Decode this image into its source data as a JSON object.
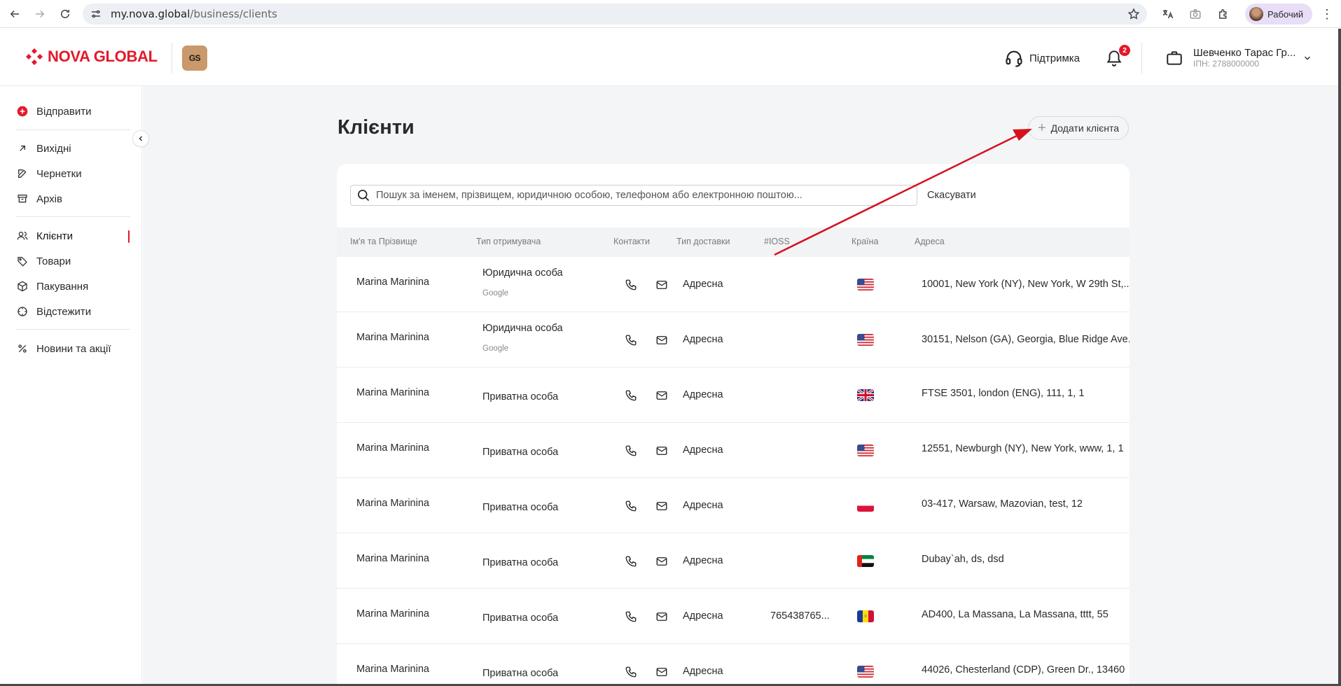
{
  "browser": {
    "url_host": "my.nova.global",
    "url_path": "/business/clients",
    "profile_label": "Рабочий"
  },
  "header": {
    "logo_text": "NOVA GLOBAL",
    "company_badge": "GS",
    "support_label": "Підтримка",
    "notifications_count": "2",
    "account_name": "Шевченко Тарас Гр...",
    "account_inn": "ІПН: 2788000000"
  },
  "sidebar": {
    "send": "Відправити",
    "items_group1": [
      "Вихідні",
      "Чернетки",
      "Архів"
    ],
    "items_group2": [
      "Клієнти",
      "Товари",
      "Пакування",
      "Відстежити"
    ],
    "news": "Новини та акції",
    "active": "Клієнти"
  },
  "page": {
    "title": "Клієнти",
    "add_button": "Додати клієнта",
    "search_placeholder": "Пошук за іменем, прізвищем, юридичною особою, телефоном або електронною поштою...",
    "cancel": "Скасувати"
  },
  "table": {
    "headers": [
      "Ім'я та Прізвище",
      "Тип отримувача",
      "Контакти",
      "Тип доставки",
      "#IOSS",
      "Країна",
      "Адреса"
    ],
    "rows": [
      {
        "name": "Marina Marinina",
        "type": "Юридична особа",
        "subtype": "Google",
        "delivery": "Адресна",
        "ioss": "",
        "country": "us",
        "address": "10001, New York (NY), New York, W 29th St,..."
      },
      {
        "name": "Marina Marinina",
        "type": "Юридична особа",
        "subtype": "Google",
        "delivery": "Адресна",
        "ioss": "",
        "country": "us",
        "address": "30151, Nelson (GA), Georgia, Blue Ridge Ave..."
      },
      {
        "name": "Marina Marinina",
        "type": "Приватна особа",
        "subtype": "",
        "delivery": "Адресна",
        "ioss": "",
        "country": "gb",
        "address": "FTSE 3501, london (ENG), 111, 1, 1"
      },
      {
        "name": "Marina Marinina",
        "type": "Приватна особа",
        "subtype": "",
        "delivery": "Адресна",
        "ioss": "",
        "country": "us",
        "address": "12551, Newburgh (NY), New York, www, 1, 1"
      },
      {
        "name": "Marina Marinina",
        "type": "Приватна особа",
        "subtype": "",
        "delivery": "Адресна",
        "ioss": "",
        "country": "pl",
        "address": "03-417, Warsaw, Mazovian, test, 12"
      },
      {
        "name": "Marina Marinina",
        "type": "Приватна особа",
        "subtype": "",
        "delivery": "Адресна",
        "ioss": "",
        "country": "ae",
        "address": "Dubay`ah, ds, dsd"
      },
      {
        "name": "Marina Marinina",
        "type": "Приватна особа",
        "subtype": "",
        "delivery": "Адресна",
        "ioss": "765438765...",
        "country": "ad",
        "address": "AD400, La Massana, La Massana, tttt, 55"
      },
      {
        "name": "Marina Marinina",
        "type": "Приватна особа",
        "subtype": "",
        "delivery": "Адресна",
        "ioss": "",
        "country": "us",
        "address": "44026, Chesterland (CDP), Green Dr., 13460"
      }
    ]
  },
  "colors": {
    "brand_red": "#e3192b",
    "badge_bg": "#c9986b",
    "main_bg": "#f4f5f7"
  }
}
